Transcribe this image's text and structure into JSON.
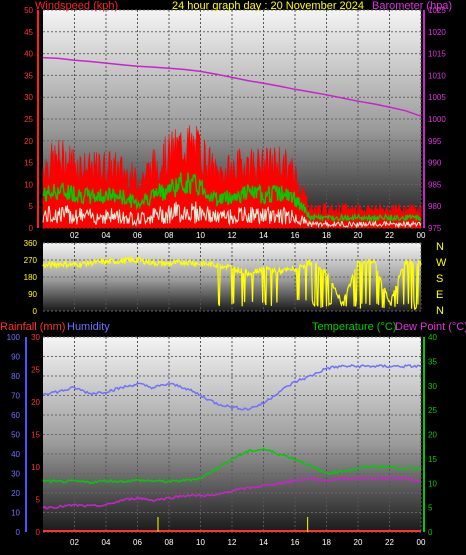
{
  "title": "24 hour graph day : 20 November 2024",
  "top_panel": {
    "left_label": "Windspeed (kph)",
    "right_label": "Barometer (hpa)",
    "left_ticks": [
      "0",
      "5",
      "10",
      "15",
      "20",
      "25",
      "30",
      "35",
      "40",
      "45",
      "50"
    ],
    "right_ticks": [
      "975",
      "980",
      "985",
      "990",
      "995",
      "1000",
      "1005",
      "1010",
      "1015",
      "1020",
      "1025"
    ]
  },
  "dir_panel": {
    "left_ticks": [
      "0",
      "90",
      "180",
      "270",
      "360"
    ],
    "right_labels": [
      "N",
      "W",
      "S",
      "E",
      "N"
    ]
  },
  "bottom_panel": {
    "rain_label": "Rainfall (mm)",
    "hum_label": "Humidity",
    "temp_label": "Temperature (°C)",
    "dew_label": "Dew Point (°C)",
    "hum_ticks": [
      "0",
      "10",
      "20",
      "30",
      "40",
      "50",
      "60",
      "70",
      "80",
      "90",
      "100"
    ],
    "rain_ticks": [
      "0",
      "5",
      "10",
      "15",
      "20",
      "25",
      "30"
    ],
    "temp_ticks": [
      "0",
      "5",
      "10",
      "15",
      "20",
      "25",
      "30",
      "35",
      "40"
    ]
  },
  "x_ticks": [
    "02",
    "04",
    "06",
    "08",
    "10",
    "12",
    "14",
    "16",
    "18",
    "20",
    "22",
    "00"
  ],
  "colors": {
    "windspeed": "#ff0000",
    "wind_avg": "#00cc00",
    "wind_lull": "#d8f0d8",
    "barometer": "#cc22cc",
    "direction": "#ffff00",
    "rainfall": "#ff3030",
    "humidity": "#7070ff",
    "temperature": "#00cc00",
    "dewpoint": "#cc22cc",
    "rain_rate": "#dddd00"
  },
  "chart_data": [
    {
      "type": "line",
      "name": "wind-barometer",
      "x_hours": [
        0,
        1,
        2,
        3,
        4,
        5,
        6,
        7,
        8,
        9,
        10,
        11,
        12,
        13,
        14,
        15,
        16,
        17,
        18,
        19,
        20,
        21,
        22,
        23,
        24
      ],
      "series": [
        {
          "name": "Windspeed (kph)",
          "axis": "left",
          "values": [
            16,
            18,
            17,
            15,
            16,
            15,
            12,
            16,
            19,
            22,
            20,
            14,
            15,
            17,
            16,
            17,
            14,
            5,
            5,
            5,
            5,
            5,
            5,
            5,
            5
          ]
        },
        {
          "name": "Barometer (hpa)",
          "axis": "right",
          "values": [
            1016,
            1015.8,
            1015.3,
            1015,
            1014.6,
            1014.2,
            1013.8,
            1013.6,
            1013.3,
            1013,
            1012.5,
            1011.8,
            1011,
            1010.2,
            1009.5,
            1008.8,
            1008,
            1007.3,
            1006.6,
            1005.8,
            1005,
            1004.3,
            1003.5,
            1002.6,
            1001.2
          ]
        }
      ],
      "ylim_left": [
        0,
        50
      ],
      "ylim_right": [
        973,
        1028
      ]
    },
    {
      "type": "line",
      "name": "wind-direction",
      "series": [
        {
          "name": "Wind Direction",
          "values": [
            240,
            250,
            245,
            255,
            260,
            265,
            270,
            255,
            250,
            260,
            250,
            245,
            230,
            200,
            225,
            210,
            220,
            260,
            200,
            40,
            250,
            270,
            40,
            260,
            250
          ]
        }
      ],
      "ylim": [
        0,
        360
      ]
    },
    {
      "type": "line",
      "name": "temp-humidity-rain",
      "x_hours": [
        0,
        1,
        2,
        3,
        4,
        5,
        6,
        7,
        8,
        9,
        10,
        11,
        12,
        13,
        14,
        15,
        16,
        17,
        18,
        19,
        20,
        21,
        22,
        23,
        24
      ],
      "series": [
        {
          "name": "Humidity",
          "axis": "left",
          "values": [
            71,
            72,
            74,
            71,
            72,
            74,
            76,
            74,
            76,
            74,
            70,
            66,
            64,
            63,
            66,
            72,
            77,
            80,
            84,
            85,
            85,
            85,
            85,
            85,
            85
          ]
        },
        {
          "name": "Temperature (°C)",
          "axis": "right",
          "values": [
            10.5,
            10.3,
            10.4,
            10.2,
            10.5,
            10.4,
            10.6,
            10.5,
            10.3,
            10.6,
            11,
            13,
            15,
            16.5,
            17,
            16,
            15,
            13.5,
            12,
            12.5,
            13,
            13.5,
            13.3,
            13,
            13
          ]
        },
        {
          "name": "Dew Point (°C)",
          "axis": "right",
          "values": [
            5,
            5.2,
            5.5,
            5.3,
            5.5,
            6.5,
            7,
            6.5,
            7,
            7.5,
            7.5,
            7.5,
            8.5,
            9,
            9.5,
            10,
            10.5,
            11,
            10.5,
            11,
            11,
            11,
            11,
            11,
            10.5
          ]
        },
        {
          "name": "Rainfall (mm)",
          "axis": "rain",
          "values": [
            0,
            0,
            0,
            0,
            0,
            0,
            0,
            0,
            0,
            0,
            0,
            0,
            0,
            0,
            0,
            0,
            0,
            0,
            0,
            0,
            0,
            0,
            0,
            0,
            0
          ]
        }
      ],
      "ylim_humidity": [
        0,
        100
      ],
      "ylim_rain": [
        0,
        30
      ],
      "ylim_temp": [
        0,
        40
      ]
    }
  ]
}
